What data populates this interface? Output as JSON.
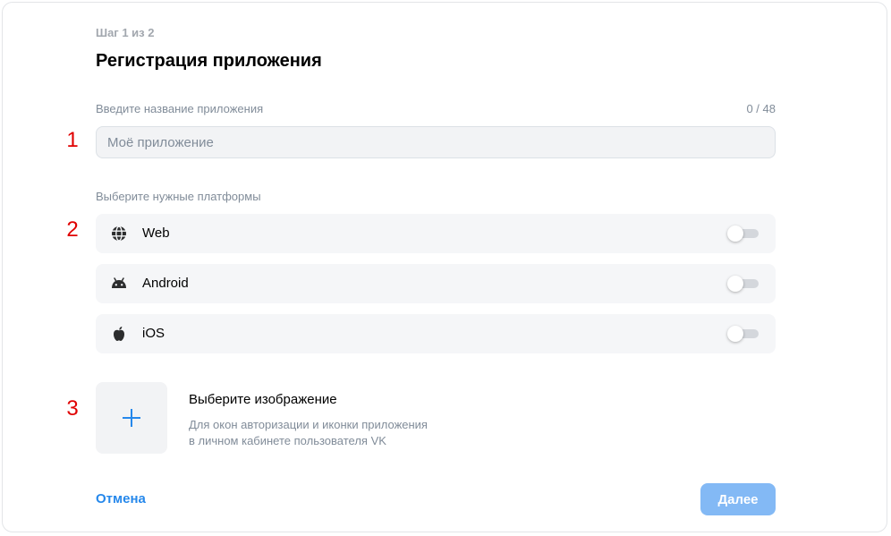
{
  "step_label": "Шаг 1 из 2",
  "title": "Регистрация приложения",
  "name_field": {
    "label": "Введите название приложения",
    "counter": "0 / 48",
    "placeholder": "Моё приложение",
    "value": ""
  },
  "platforms": {
    "label": "Выберите нужные платформы",
    "items": [
      {
        "label": "Web",
        "icon": "globe-icon",
        "enabled": false
      },
      {
        "label": "Android",
        "icon": "android-icon",
        "enabled": false
      },
      {
        "label": "iOS",
        "icon": "apple-icon",
        "enabled": false
      }
    ]
  },
  "image": {
    "title": "Выберите изображение",
    "description_line1": "Для окон авторизации и иконки приложения",
    "description_line2": "в личном кабинете пользователя VK"
  },
  "annotations": [
    "1",
    "2",
    "3"
  ],
  "footer": {
    "cancel_label": "Отмена",
    "next_label": "Далее"
  },
  "colors": {
    "accent": "#2688eb",
    "next_button_disabled": "#83b9f5",
    "annotation": "#e00000"
  }
}
